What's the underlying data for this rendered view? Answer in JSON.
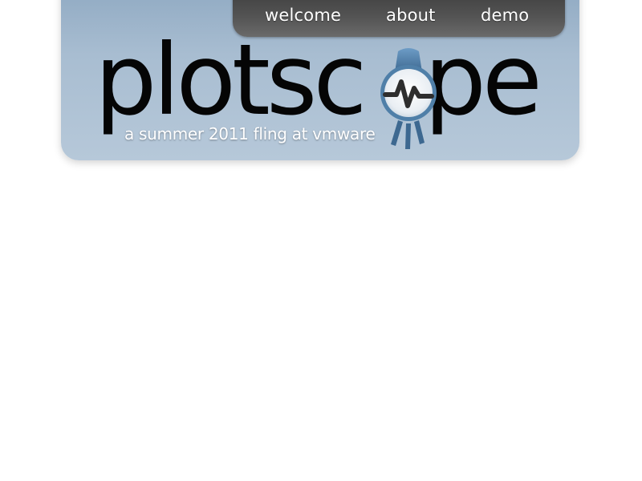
{
  "nav": {
    "items": [
      {
        "label": "welcome"
      },
      {
        "label": "about"
      },
      {
        "label": "demo"
      }
    ]
  },
  "logo": {
    "text_before": "plotsc",
    "text_after": "pe",
    "icon": "magnifier-waveform-icon"
  },
  "tagline": "a summer 2011 fling at vmware",
  "colors": {
    "header_bg": "#b6c8d9",
    "nav_bg": "#555555",
    "logo_text": "#050505",
    "logo_accent": "#4f7fa8"
  }
}
